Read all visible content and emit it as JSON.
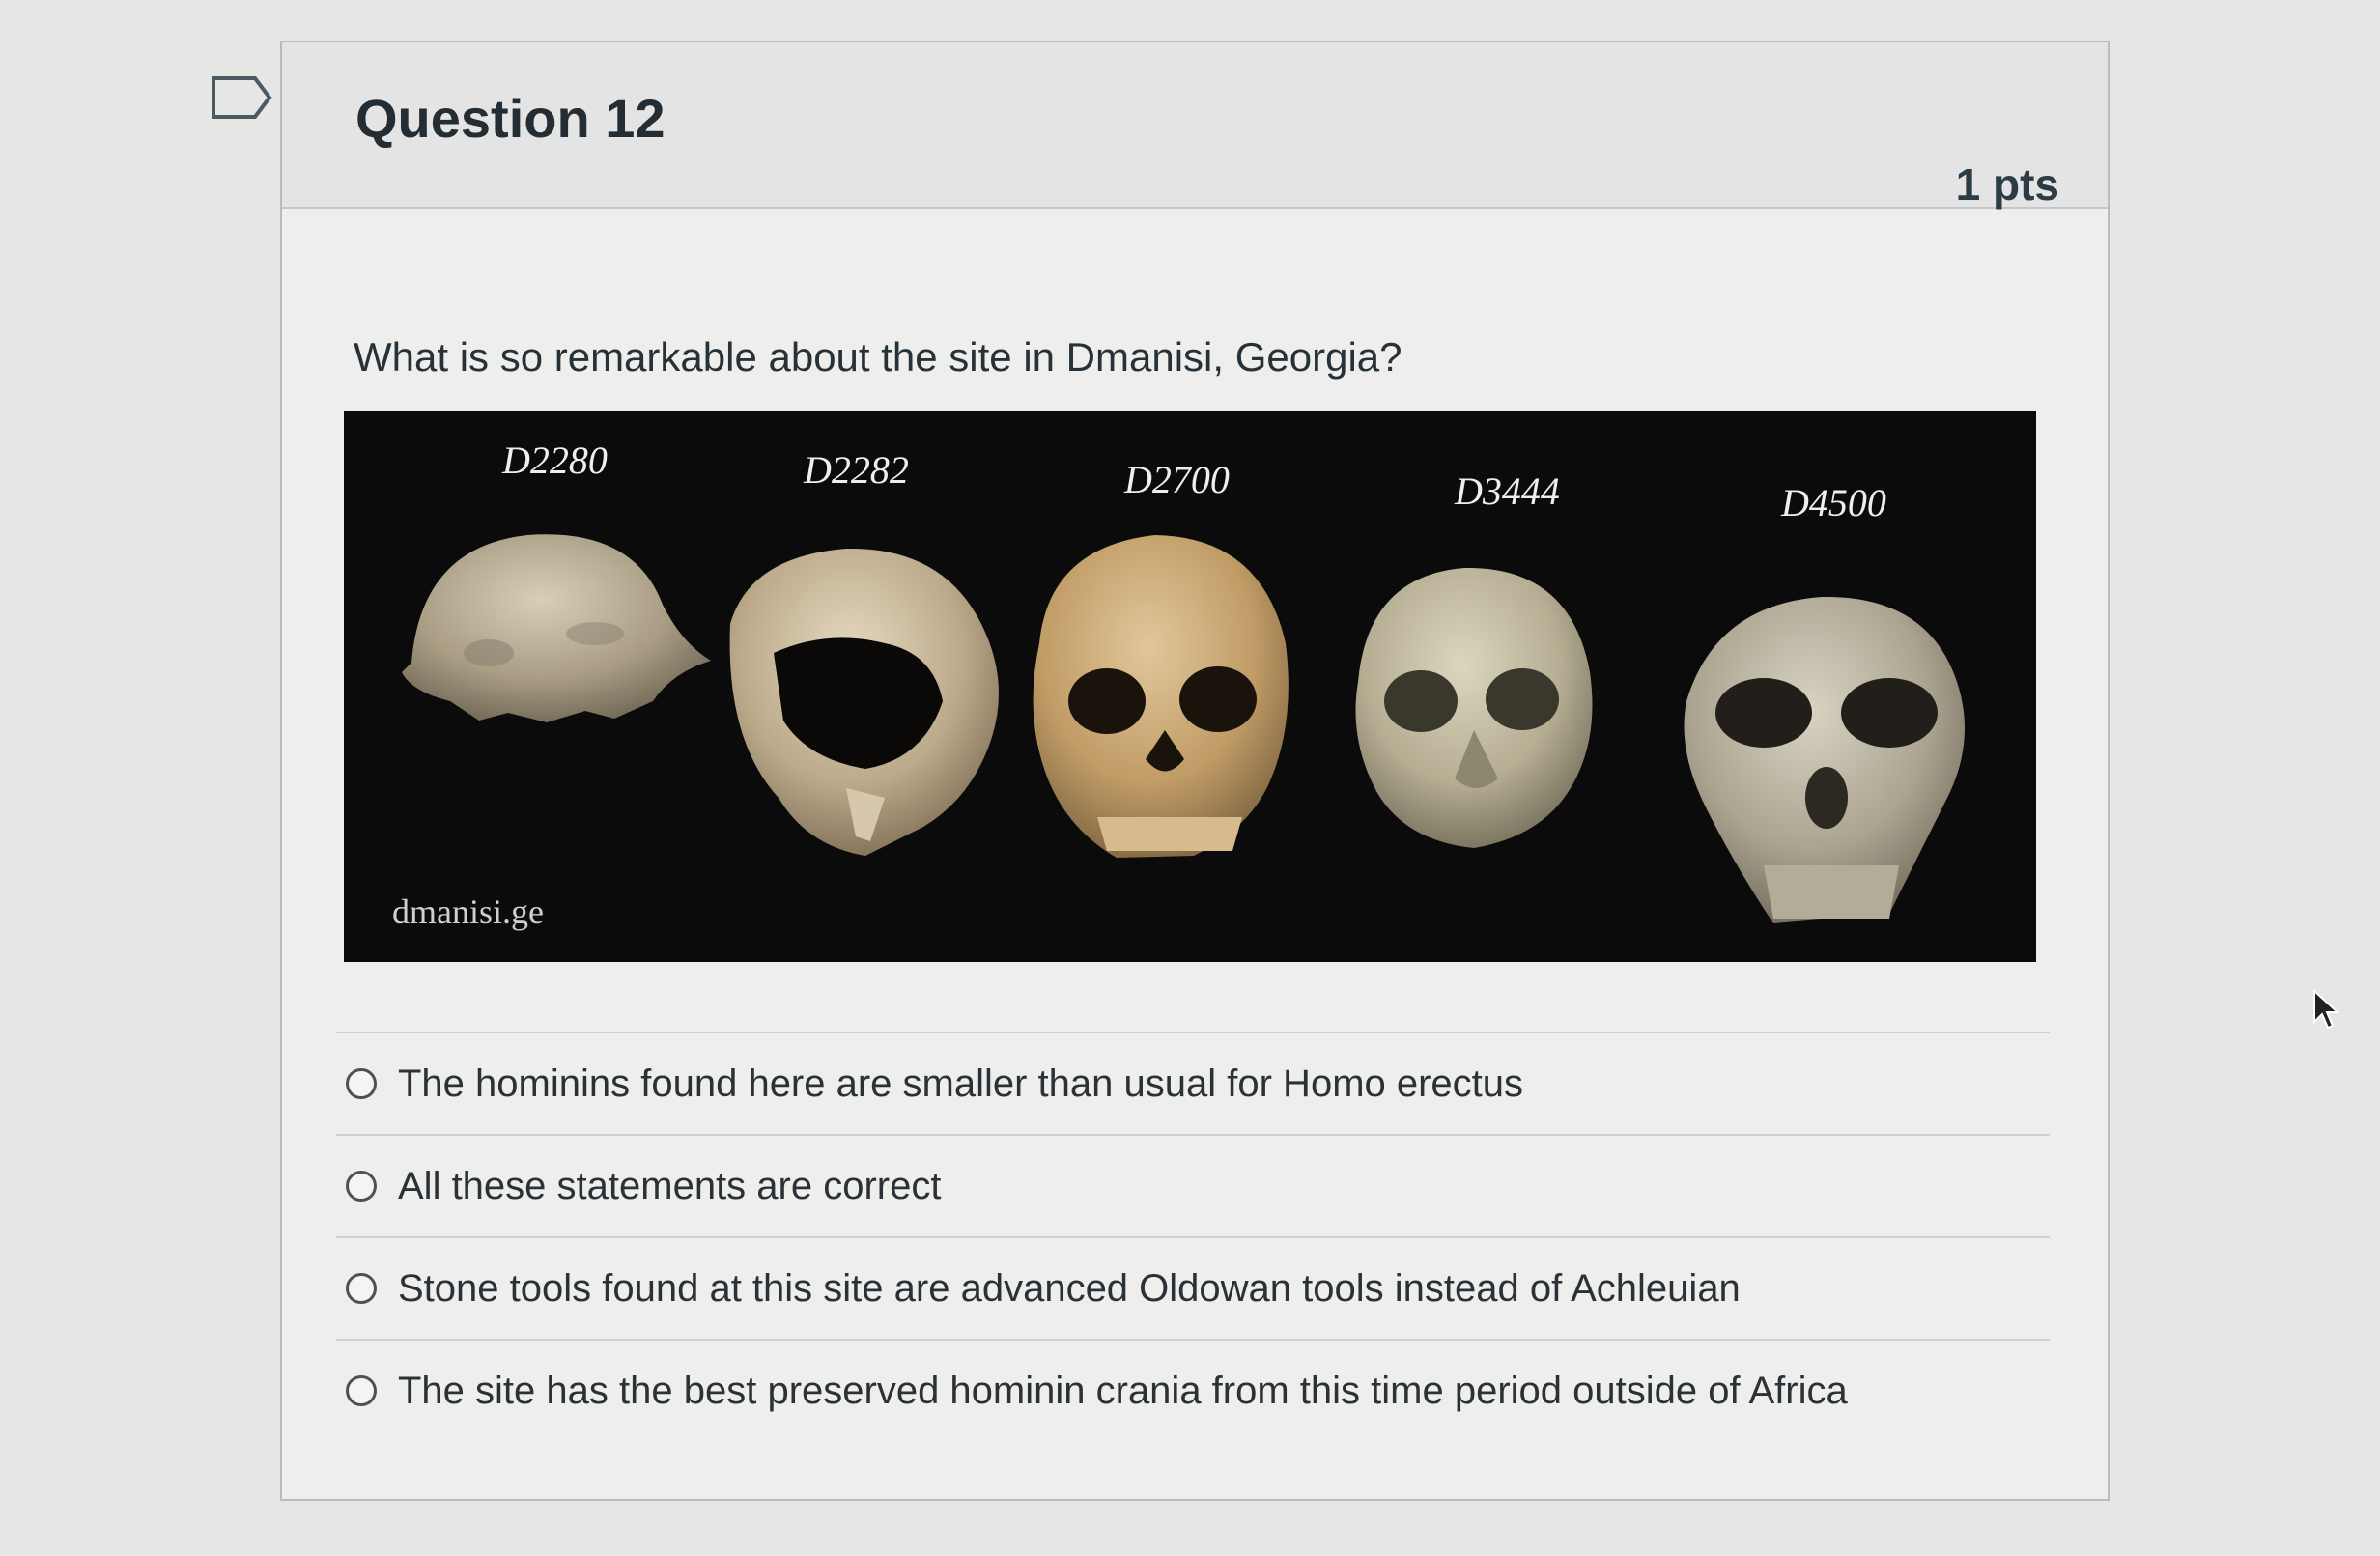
{
  "question": {
    "title": "Question 12",
    "points": "1 pts",
    "text": "What is so remarkable about the site in Dmanisi, Georgia?"
  },
  "figure": {
    "specimens": [
      "D2280",
      "D2282",
      "D2700",
      "D3444",
      "D4500"
    ],
    "watermark": "dmanisi.ge"
  },
  "answers": [
    {
      "label": "The hominins found here are smaller than usual for Homo erectus",
      "selected": false
    },
    {
      "label": "All these statements are correct",
      "selected": false
    },
    {
      "label": "Stone tools found at this site are advanced Oldowan tools instead of Achleuian",
      "selected": false
    },
    {
      "label": "The site has the best preserved hominin crania from this time period outside of Africa",
      "selected": false
    }
  ],
  "colors": {
    "page_background": "#e6e6e4",
    "card_header": "#e3e4e3",
    "text": "#2d3b45",
    "figure_background": "#0c0b0b"
  }
}
